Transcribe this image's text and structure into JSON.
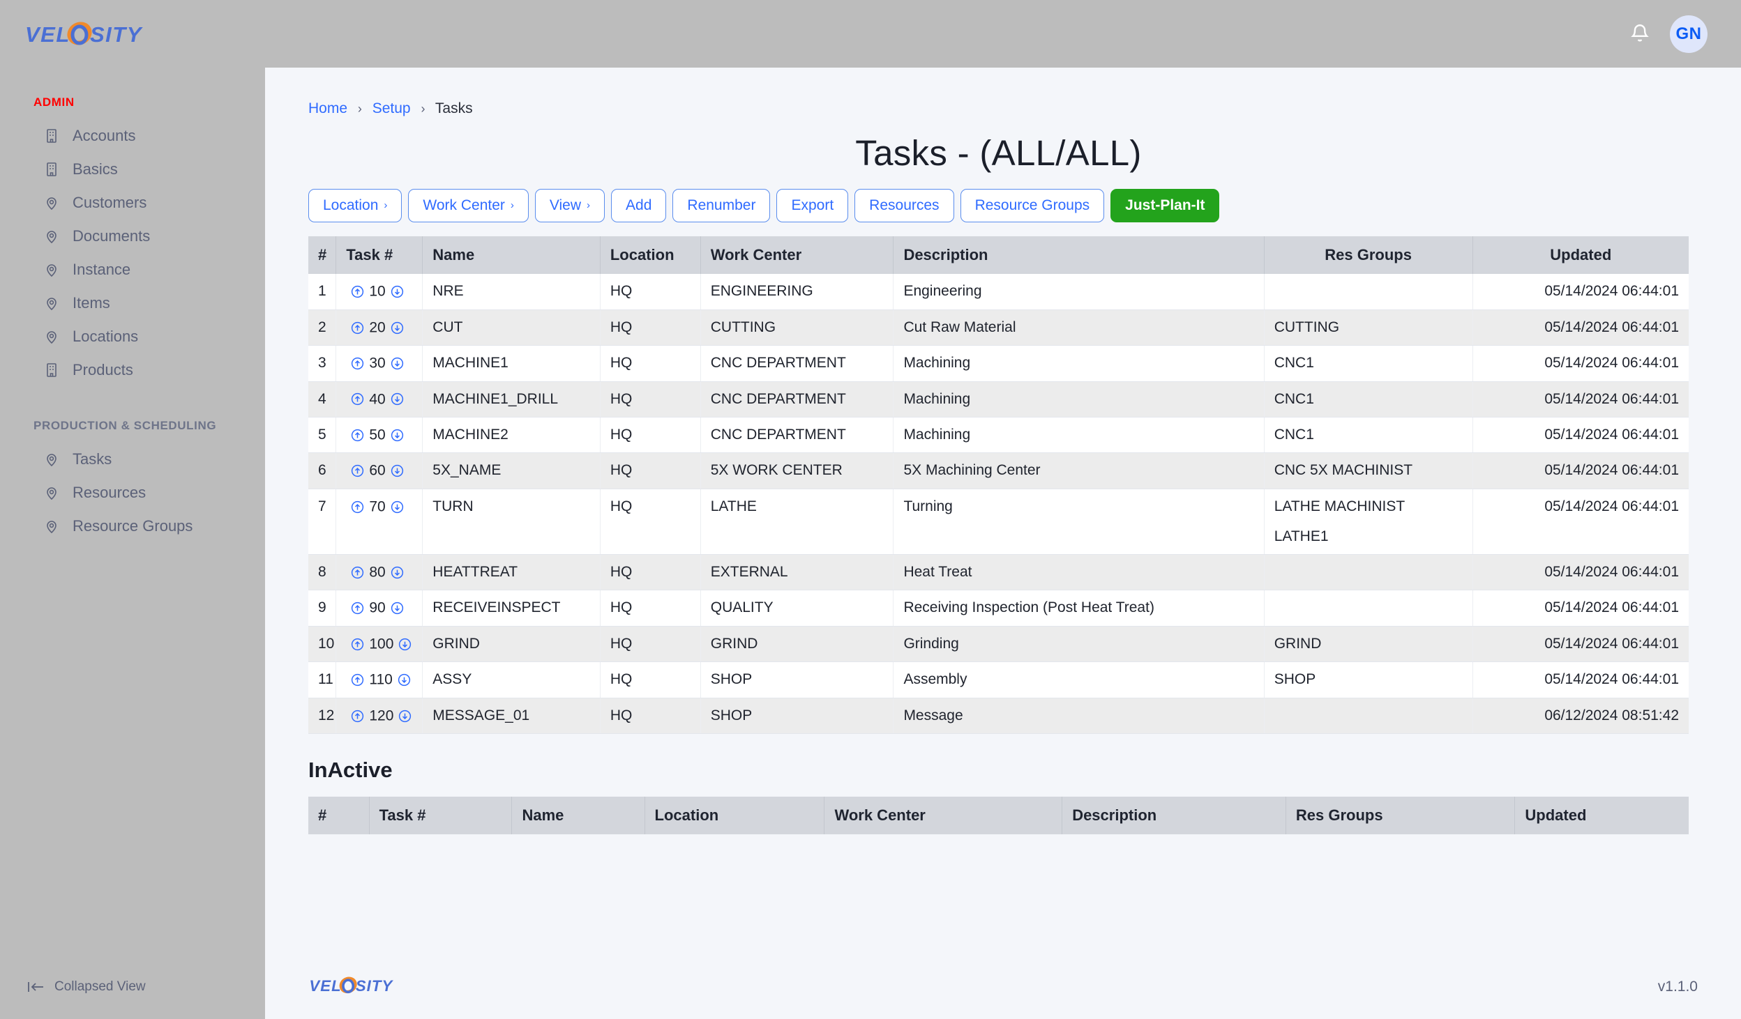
{
  "header": {
    "logo_text": "VELOSITY",
    "logo_colors": {
      "text": "#4a6fd4",
      "swirl": "#f08a2c"
    },
    "notifications_icon": "bell-icon",
    "avatar_initials": "GN",
    "avatar_bg": "#dfe6fb",
    "avatar_color": "#0b5cf5",
    "bar_bg": "#bcbcbc"
  },
  "sidebar": {
    "sections": [
      {
        "title": "ADMIN",
        "title_color": "#ff0000",
        "items": [
          {
            "label": "Accounts",
            "icon": "building-icon"
          },
          {
            "label": "Basics",
            "icon": "building-icon"
          },
          {
            "label": "Customers",
            "icon": "map-pin-icon"
          },
          {
            "label": "Documents",
            "icon": "map-pin-icon"
          },
          {
            "label": "Instance",
            "icon": "map-pin-icon"
          },
          {
            "label": "Items",
            "icon": "map-pin-icon"
          },
          {
            "label": "Locations",
            "icon": "map-pin-icon"
          },
          {
            "label": "Products",
            "icon": "building-icon"
          }
        ]
      },
      {
        "title": "PRODUCTION & SCHEDULING",
        "title_color": "#6e7489",
        "items": [
          {
            "label": "Tasks",
            "icon": "map-pin-icon"
          },
          {
            "label": "Resources",
            "icon": "map-pin-icon"
          },
          {
            "label": "Resource Groups",
            "icon": "map-pin-icon"
          }
        ]
      }
    ],
    "collapse_label": "Collapsed View",
    "collapse_icon": "collapse-left-icon"
  },
  "breadcrumb": {
    "home": "Home",
    "setup": "Setup",
    "current": "Tasks",
    "separator": "›"
  },
  "page": {
    "title": "Tasks - (ALL/ALL)"
  },
  "toolbar": {
    "buttons": [
      {
        "label": "Location",
        "caret": "›",
        "style": "outline"
      },
      {
        "label": "Work Center",
        "caret": "›",
        "style": "outline"
      },
      {
        "label": "View",
        "caret": "›",
        "style": "outline"
      },
      {
        "label": "Add",
        "caret": "",
        "style": "outline"
      },
      {
        "label": "Renumber",
        "caret": "",
        "style": "outline"
      },
      {
        "label": "Export",
        "caret": "",
        "style": "outline"
      },
      {
        "label": "Resources",
        "caret": "",
        "style": "outline"
      },
      {
        "label": "Resource Groups",
        "caret": "",
        "style": "outline"
      },
      {
        "label": "Just-Plan-It",
        "caret": "",
        "style": "primary"
      }
    ],
    "primary_color": "#23a31c",
    "outline_color": "#2f6bff"
  },
  "active_table": {
    "columns": [
      "#",
      "Task #",
      "Name",
      "Location",
      "Work Center",
      "Description",
      "Res Groups",
      "Updated"
    ],
    "row_icons": {
      "up": "circle-arrow-up-icon",
      "down": "circle-arrow-down-icon"
    },
    "rows": [
      {
        "idx": "1",
        "task": "10",
        "name": "NRE",
        "location": "HQ",
        "work_center": "ENGINEERING",
        "description": "Engineering",
        "res_groups": [],
        "updated": "05/14/2024 06:44:01"
      },
      {
        "idx": "2",
        "task": "20",
        "name": "CUT",
        "location": "HQ",
        "work_center": "CUTTING",
        "description": "Cut Raw Material",
        "res_groups": [
          "CUTTING"
        ],
        "updated": "05/14/2024 06:44:01"
      },
      {
        "idx": "3",
        "task": "30",
        "name": "MACHINE1",
        "location": "HQ",
        "work_center": "CNC DEPARTMENT",
        "description": "Machining",
        "res_groups": [
          "CNC1"
        ],
        "updated": "05/14/2024 06:44:01"
      },
      {
        "idx": "4",
        "task": "40",
        "name": "MACHINE1_DRILL",
        "location": "HQ",
        "work_center": "CNC DEPARTMENT",
        "description": "Machining",
        "res_groups": [
          "CNC1"
        ],
        "updated": "05/14/2024 06:44:01"
      },
      {
        "idx": "5",
        "task": "50",
        "name": "MACHINE2",
        "location": "HQ",
        "work_center": "CNC DEPARTMENT",
        "description": "Machining",
        "res_groups": [
          "CNC1"
        ],
        "updated": "05/14/2024 06:44:01"
      },
      {
        "idx": "6",
        "task": "60",
        "name": "5X_NAME",
        "location": "HQ",
        "work_center": "5X WORK CENTER",
        "description": "5X Machining Center",
        "res_groups": [
          "CNC 5X MACHINIST"
        ],
        "updated": "05/14/2024 06:44:01"
      },
      {
        "idx": "7",
        "task": "70",
        "name": "TURN",
        "location": "HQ",
        "work_center": "LATHE",
        "description": "Turning",
        "res_groups": [
          "LATHE MACHINIST",
          "LATHE1"
        ],
        "updated": "05/14/2024 06:44:01"
      },
      {
        "idx": "8",
        "task": "80",
        "name": "HEATTREAT",
        "location": "HQ",
        "work_center": "EXTERNAL",
        "description": "Heat Treat",
        "res_groups": [],
        "updated": "05/14/2024 06:44:01"
      },
      {
        "idx": "9",
        "task": "90",
        "name": "RECEIVEINSPECT",
        "location": "HQ",
        "work_center": "QUALITY",
        "description": "Receiving Inspection (Post Heat Treat)",
        "res_groups": [],
        "updated": "05/14/2024 06:44:01"
      },
      {
        "idx": "10",
        "task": "100",
        "name": "GRIND",
        "location": "HQ",
        "work_center": "GRIND",
        "description": "Grinding",
        "res_groups": [
          "GRIND"
        ],
        "updated": "05/14/2024 06:44:01"
      },
      {
        "idx": "11",
        "task": "110",
        "name": "ASSY",
        "location": "HQ",
        "work_center": "SHOP",
        "description": "Assembly",
        "res_groups": [
          "SHOP"
        ],
        "updated": "05/14/2024 06:44:01"
      },
      {
        "idx": "12",
        "task": "120",
        "name": "MESSAGE_01",
        "location": "HQ",
        "work_center": "SHOP",
        "description": "Message",
        "res_groups": [],
        "updated": "06/12/2024 08:51:42"
      }
    ]
  },
  "inactive_table": {
    "title": "InActive",
    "columns": [
      "#",
      "Task #",
      "Name",
      "Location",
      "Work Center",
      "Description",
      "Res Groups",
      "Updated"
    ],
    "rows": []
  },
  "footer": {
    "logo_text": "VELOSITY",
    "version": "v1.1.0"
  }
}
